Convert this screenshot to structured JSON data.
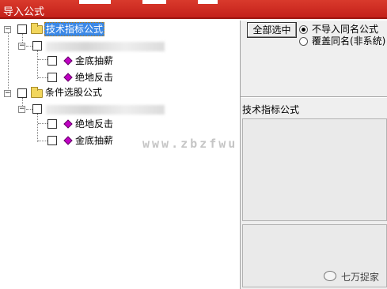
{
  "window": {
    "title": "导入公式"
  },
  "tree": {
    "groups": [
      {
        "label": "技术指标公式",
        "children": [
          "金底抽薪",
          "绝地反击"
        ]
      },
      {
        "label": "条件选股公式",
        "children": [
          "绝地反击",
          "金底抽薪"
        ]
      }
    ]
  },
  "options": {
    "select_all": "全部选中",
    "radio_no_import": "不导入同名公式",
    "radio_overwrite": "覆盖同名(非系统)"
  },
  "panel": {
    "section_title": "技术指标公式"
  },
  "watermark": "www.zbzfwu.com",
  "brand": "七万捉家",
  "icons": {
    "expand": "minus-expander-icon",
    "folder": "folder-icon",
    "formula": "diamond-formula-icon"
  },
  "colors": {
    "titlebar": "#c4201a",
    "selection": "#3b88e6",
    "formula_icon": "#c100c4",
    "folder": "#f2d65c"
  }
}
